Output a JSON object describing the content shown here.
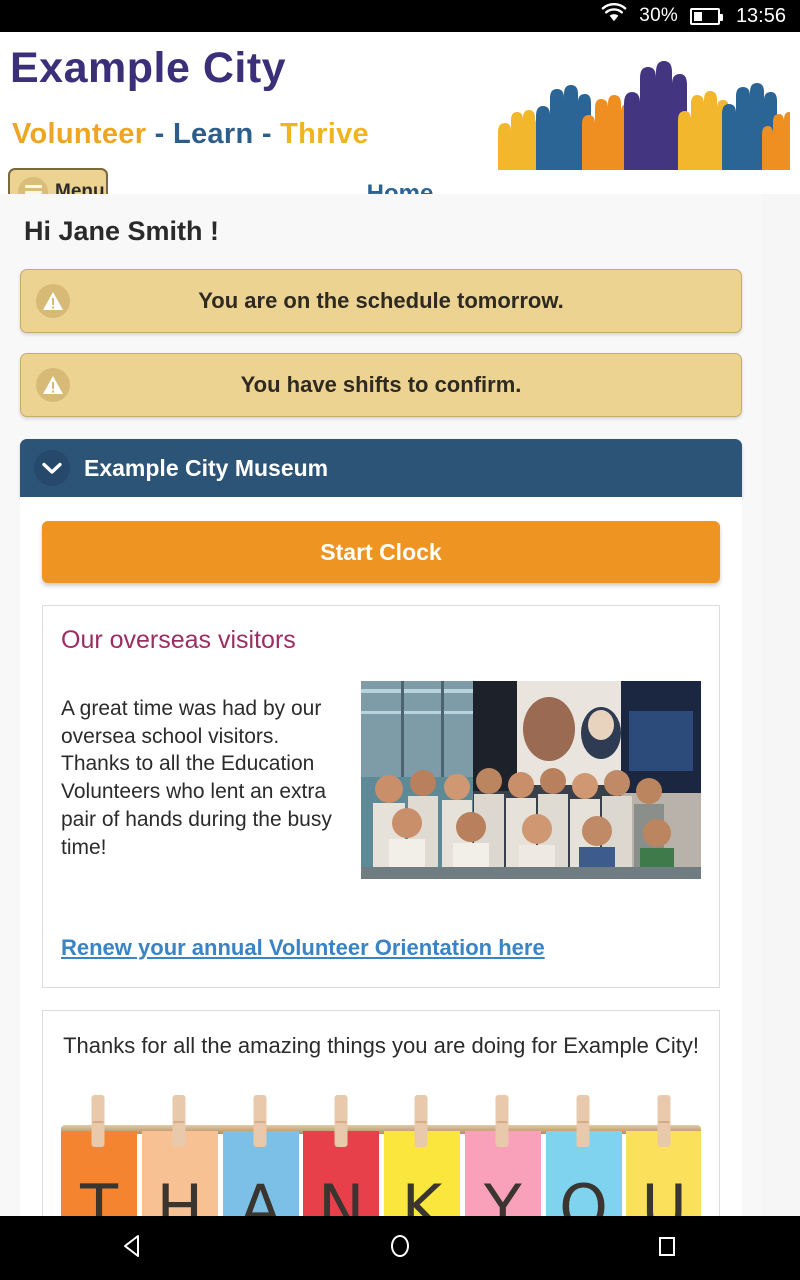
{
  "status_bar": {
    "wifi_icon": "wifi-icon",
    "battery_percent": "30%",
    "battery_icon": "battery-icon",
    "time": "13:56"
  },
  "header": {
    "brand_title": "Example City",
    "tagline": {
      "word1": "Volunteer",
      "dash1": "-",
      "word2": "Learn",
      "dash2": "-",
      "word3": "Thrive"
    },
    "logo_icon": "raised-hands-logo",
    "menu_button": {
      "label": "Menu",
      "icon": "hamburger-icon"
    },
    "nav_home": "Home"
  },
  "main": {
    "greeting": "Hi Jane Smith !",
    "alerts": [
      {
        "icon": "warning-icon",
        "text": "You are on the schedule tomorrow."
      },
      {
        "icon": "warning-icon",
        "text": "You have shifts to confirm."
      }
    ],
    "collapse_panel": {
      "title": "Example City Museum",
      "chevron_icon": "chevron-down-icon"
    },
    "start_clock_label": "Start Clock",
    "news_card": {
      "title": "Our overseas visitors",
      "body": "A great time was had by our oversea school visitors.  Thanks to all the Education Volunteers who lent an extra pair of hands during the busy time!",
      "photo_alt": "group-photo-students",
      "link_text": "Renew your annual Volunteer Orientation here"
    },
    "thanks_card": {
      "text": "Thanks for all the amazing things you are doing for Example City!",
      "image_alt": "thank-you-clothesline-image",
      "letters": [
        "T",
        "H",
        "A",
        "N",
        "K",
        "Y",
        "O",
        "U"
      ],
      "letter_colors": [
        "#f4842f",
        "#f8c193",
        "#7cc0e8",
        "#e8404a",
        "#fae63c",
        "#f9a0bb",
        "#7fd3ee",
        "#fbe05c"
      ]
    }
  },
  "nav_bar": {
    "back_icon": "back-triangle-icon",
    "home_icon": "home-circle-icon",
    "recents_icon": "recents-square-icon"
  },
  "colors": {
    "brand_purple": "#3b2f7a",
    "brand_orange": "#efa51f",
    "brand_blue": "#2d5d8a",
    "brand_gold": "#f0b51e",
    "alert_bg": "#ecd391",
    "panel_header": "#2c5477",
    "action_orange": "#ee9422",
    "link_blue": "#3a83c4",
    "news_title": "#9c2d62"
  }
}
